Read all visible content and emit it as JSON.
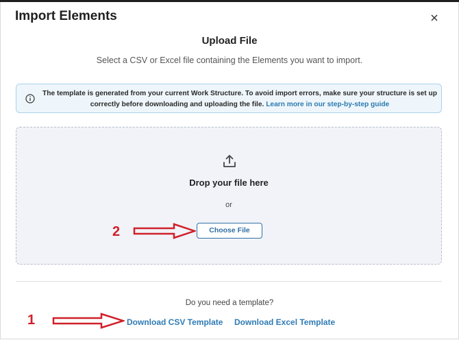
{
  "dialog": {
    "title": "Import Elements",
    "close_icon": "close-icon"
  },
  "upload": {
    "title": "Upload File",
    "subtitle": "Select a CSV or Excel file containing the Elements you want to import."
  },
  "info_banner": {
    "icon": "info-icon",
    "text": "The template is generated from your current Work Structure. To avoid import errors, make sure your structure is set up correctly before downloading and uploading the file.",
    "link_label": "Learn more in our step-by-step guide"
  },
  "dropzone": {
    "icon": "upload-icon",
    "drop_text": "Drop your file here",
    "or_text": "or",
    "choose_label": "Choose File"
  },
  "templates": {
    "question": "Do you need a template?",
    "csv_label": "Download CSV Template",
    "excel_label": "Download Excel Template"
  },
  "annotations": {
    "label_1": "1",
    "label_2": "2",
    "color": "#d0202a"
  },
  "colors": {
    "accent": "#2f7bb5",
    "info_bg": "#eef6fb",
    "dropzone_bg": "#f1f3f8"
  }
}
